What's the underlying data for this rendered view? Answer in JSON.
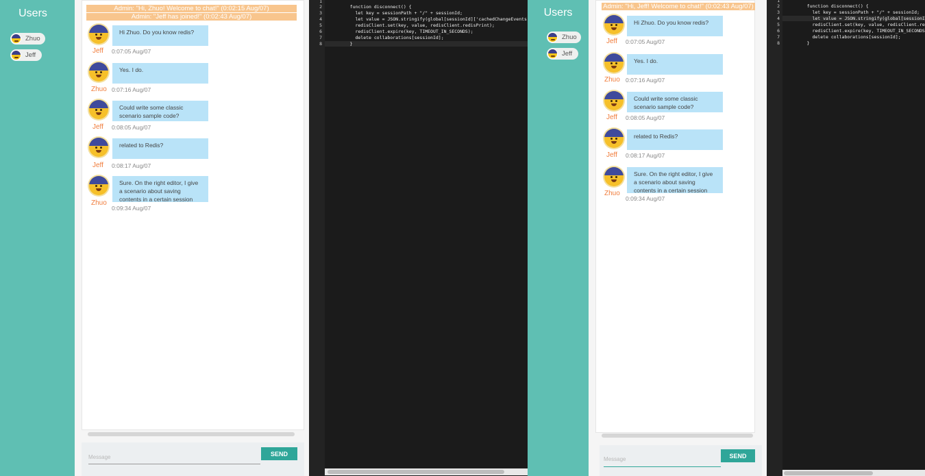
{
  "left": {
    "users_title": "Users",
    "users": [
      "Zhuo",
      "Jeff"
    ],
    "admin_messages": [
      "Admin: \"Hi, Zhuo! Welcome to chat!\" (0:02:15 Aug/07)",
      "Admin: \"Jeff has joined!\" (0:02:43 Aug/07)"
    ],
    "messages": [
      {
        "text": "Hi Zhuo. Do you know redis?",
        "sender": "Jeff",
        "time": "0:07:05 Aug/07"
      },
      {
        "text": "Yes. I do.",
        "sender": "Zhuo",
        "time": "0:07:16 Aug/07"
      },
      {
        "text": "Could write some classic scenario sample code?",
        "sender": "Jeff",
        "time": "0:08:05 Aug/07"
      },
      {
        "text": "related to Redis?",
        "sender": "Jeff",
        "time": "0:08:17 Aug/07"
      },
      {
        "text": "Sure. On the right editor, I give a scenario about saving contents in a certain session",
        "sender": "Zhuo",
        "time": "0:09:34 Aug/07"
      }
    ],
    "input_placeholder": "Message",
    "send_label": "SEND"
  },
  "right": {
    "users_title": "Users",
    "users": [
      "Zhuo",
      "Jeff"
    ],
    "admin_messages": [
      "Admin: \"Hi, Jeff! Welcome to chat!\" (0:02:43 Aug/07)"
    ],
    "messages": [
      {
        "text": "Hi Zhuo. Do you know redis?",
        "sender": "Jeff",
        "time": "0:07:05 Aug/07"
      },
      {
        "text": "Yes. I do.",
        "sender": "Zhuo",
        "time": "0:07:16 Aug/07"
      },
      {
        "text": "Could write some classic scenario sample code?",
        "sender": "Jeff",
        "time": "0:08:05 Aug/07"
      },
      {
        "text": "related to Redis?",
        "sender": "Jeff",
        "time": "0:08:17 Aug/07"
      },
      {
        "text": "Sure. On the right editor, I give a scenario about saving contents in a certain session",
        "sender": "Zhuo",
        "time": "0:09:34 Aug/07"
      }
    ],
    "input_placeholder": "Message",
    "send_label": "SEND"
  },
  "editor_left": {
    "line_numbers": [
      "1",
      "2",
      "3",
      "4",
      "5",
      "6",
      "7",
      "8"
    ],
    "lines": [
      "",
      "    function disconnect() {",
      "      let key = sessionPath + \"/\" + sessionId;",
      "      let value = JSON.stringify(global[sessionId]['cachedChangeEvents']);",
      "      redisClient.set(key, value, redisClient.redisPrint);",
      "      redisClient.expire(key, TIMEOUT_IN_SECONDS);",
      "      delete collaborations[sessionId];",
      "    }"
    ]
  },
  "editor_right": {
    "line_numbers": [
      "1",
      "2",
      "3",
      "4",
      "5",
      "6",
      "7",
      "8"
    ],
    "lines": [
      "",
      "    function disconnect() {",
      "      let key = sessionPath + \"/\" + sessionId;",
      "      let value = JSON.stringify(global[sessionId]['cachedChangeEvents']);",
      "      redisClient.set(key, value, redisClient.redisPrint);",
      "      redisClient.expire(key, TIMEOUT_IN_SECONDS);",
      "      delete collaborations[sessionId];",
      "    }"
    ]
  },
  "colors": {
    "sidebar": "#5fbfb3",
    "bubble": "#b9e3f8",
    "admin_bar": "#f8c58d",
    "sender": "#f07c3b",
    "send_button": "#2fa699",
    "editor_bg": "#1b1b1b"
  }
}
